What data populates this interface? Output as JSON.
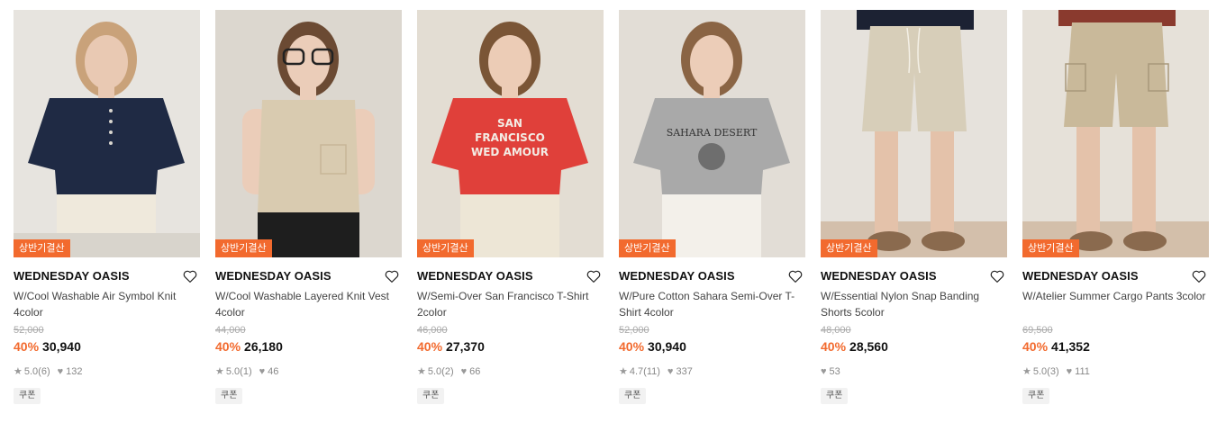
{
  "products": [
    {
      "badge": "상반기결산",
      "brand": "WEDNESDAY OASIS",
      "name": "W/Cool Washable Air Symbol Knit 4color",
      "original_price": "52,000",
      "discount": "40%",
      "price": "30,940",
      "rating": "5.0",
      "reviews": "(6)",
      "likes": "132",
      "coupon": "쿠폰",
      "image": {
        "bg": "#e7e4df",
        "top_color": "#1f2a44",
        "bottom_color": "#efe9dc",
        "skin": "#e9c9b3",
        "hair": "#c9a27a"
      }
    },
    {
      "badge": "상반기결산",
      "brand": "WEDNESDAY OASIS",
      "name": "W/Cool Washable Layered Knit Vest 4color",
      "original_price": "44,000",
      "discount": "40%",
      "price": "26,180",
      "rating": "5.0",
      "reviews": "(1)",
      "likes": "46",
      "coupon": "쿠폰",
      "image": {
        "bg": "#dcd7cf",
        "top_color": "#d9cbb0",
        "bottom_color": "#1e1e1e",
        "skin": "#ebcdb9",
        "hair": "#6b4a33"
      }
    },
    {
      "badge": "상반기결산",
      "brand": "WEDNESDAY OASIS",
      "name": "W/Semi-Over San Francisco T-Shirt 2color",
      "original_price": "46,000",
      "discount": "40%",
      "price": "27,370",
      "rating": "5.0",
      "reviews": "(2)",
      "likes": "66",
      "coupon": "쿠폰",
      "image": {
        "bg": "#e3ddd3",
        "top_color": "#e0403a",
        "bottom_color": "#ede6d6",
        "skin": "#ecccb6",
        "hair": "#7a5536",
        "print": "SAN FRANCISCO WED AMOUR"
      }
    },
    {
      "badge": "상반기결산",
      "brand": "WEDNESDAY OASIS",
      "name": "W/Pure Cotton Sahara Semi-Over T-Shirt 4color",
      "original_price": "52,000",
      "discount": "40%",
      "price": "30,940",
      "rating": "4.7",
      "reviews": "(11)",
      "likes": "337",
      "coupon": "쿠폰",
      "image": {
        "bg": "#e2ddd6",
        "top_color": "#a9a9a9",
        "bottom_color": "#f3f0ea",
        "skin": "#eccdb8",
        "hair": "#8a6444",
        "print": "SAHARA DESERT"
      }
    },
    {
      "badge": "상반기결산",
      "brand": "WEDNESDAY OASIS",
      "name": "W/Essential Nylon Snap Banding Shorts 5color",
      "original_price": "48,000",
      "discount": "40%",
      "price": "28,560",
      "rating": "",
      "reviews": "",
      "likes": "53",
      "coupon": "쿠폰",
      "image": {
        "bg": "#e6e2dc",
        "top_color": "#1c2233",
        "bottom_color": "#d7ceb9",
        "skin": "#e4c2aa",
        "shoes": "#8a6a4e"
      }
    },
    {
      "badge": "상반기결산",
      "brand": "WEDNESDAY OASIS",
      "name": "W/Atelier Summer Cargo Pants 3color",
      "original_price": "69,500",
      "discount": "40%",
      "price": "41,352",
      "rating": "5.0",
      "reviews": "(3)",
      "likes": "111",
      "coupon": "쿠폰",
      "image": {
        "bg": "#e6e1d9",
        "top_color": "#8a3a2e",
        "bottom_color": "#c9b99a",
        "skin": "#e4c2aa",
        "shoes": "#8a6a4e"
      }
    }
  ],
  "colors": {
    "accent": "#f26a2e",
    "text": "#111111",
    "muted": "#888888"
  },
  "icons": {
    "like": "heart-outline-icon",
    "star": "star-icon",
    "heart_count": "heart-filled-icon"
  }
}
